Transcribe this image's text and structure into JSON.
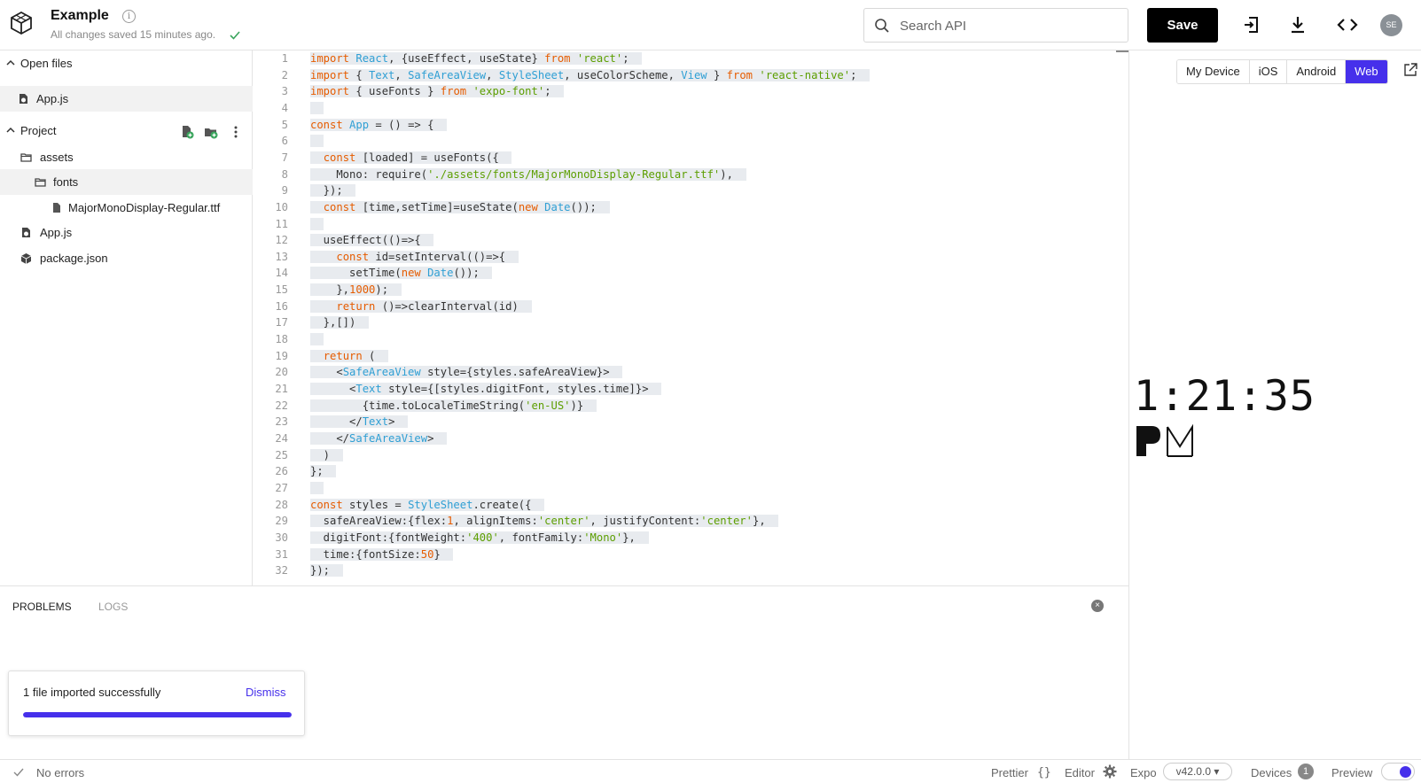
{
  "header": {
    "project_title": "Example",
    "info_glyph": "i",
    "saved_status": "All changes saved 15 minutes ago.",
    "search_placeholder": "Search API",
    "save_label": "Save",
    "avatar_initials": "SE",
    "icons": [
      "logo-icon",
      "info-icon",
      "check-icon",
      "search-icon",
      "import-icon",
      "download-icon",
      "code-icon"
    ]
  },
  "sidebar": {
    "open_files_label": "Open files",
    "open_files": [
      {
        "name": "App.js",
        "icon": "js-file-icon"
      }
    ],
    "project_label": "Project",
    "project_actions": [
      "new-file-icon",
      "new-folder-icon",
      "more-vertical-icon"
    ],
    "tree": [
      {
        "name": "assets",
        "icon": "folder-icon"
      },
      {
        "name": "fonts",
        "icon": "folder-icon"
      },
      {
        "name": "MajorMonoDisplay-Regular.ttf",
        "icon": "file-icon"
      },
      {
        "name": "App.js",
        "icon": "js-file-icon"
      },
      {
        "name": "package.json",
        "icon": "package-icon"
      }
    ]
  },
  "editor": {
    "lines": [
      "import React, {useEffect, useState} from 'react';",
      "import { Text, SafeAreaView, StyleSheet, useColorScheme, View } from 'react-native';",
      "import { useFonts } from 'expo-font';",
      "",
      "const App = () => {",
      "",
      "  const [loaded] = useFonts({",
      "    Mono: require('./assets/fonts/MajorMonoDisplay-Regular.ttf'),",
      "  });",
      "  const [time,setTime]=useState(new Date());",
      "",
      "  useEffect(()=>{",
      "    const id=setInterval(()=>{",
      "      setTime(new Date());",
      "    },1000);",
      "    return ()=>clearInterval(id)",
      "  },[])",
      "",
      "  return (",
      "    <SafeAreaView style={styles.safeAreaView}>",
      "      <Text style={[styles.digitFont, styles.time]}>",
      "        {time.toLocaleTimeString('en-US')}",
      "      </Text>",
      "    </SafeAreaView>",
      "  )",
      "};",
      "",
      "const styles = StyleSheet.create({",
      "  safeAreaView:{flex:1, alignItems:'center', justifyContent:'center'},",
      "  digitFont:{fontWeight:'400', fontFamily:'Mono'},",
      "  time:{fontSize:50}",
      "});"
    ]
  },
  "preview": {
    "targets": [
      "My Device",
      "iOS",
      "Android",
      "Web"
    ],
    "active_target": "Web",
    "clock_time": "1:21:35",
    "clock_pm": "PM"
  },
  "bottom_panel": {
    "tabs": [
      "PROBLEMS",
      "LOGS"
    ],
    "close_glyph": "×",
    "toast_message": "1 file imported successfully",
    "toast_dismiss": "Dismiss",
    "toast_progress": 1.0
  },
  "statusbar": {
    "errors": "No errors",
    "prettier": "Prettier",
    "prettier_glyph": "{}",
    "editor": "Editor",
    "expo": "Expo",
    "expo_version": "v42.0.0 ▾",
    "devices": "Devices",
    "devices_count": "1",
    "preview": "Preview"
  },
  "colors": {
    "accent": "#4630eb",
    "keyword": "#e65c00",
    "string": "#5c9e00",
    "component": "#2f9fd4"
  }
}
